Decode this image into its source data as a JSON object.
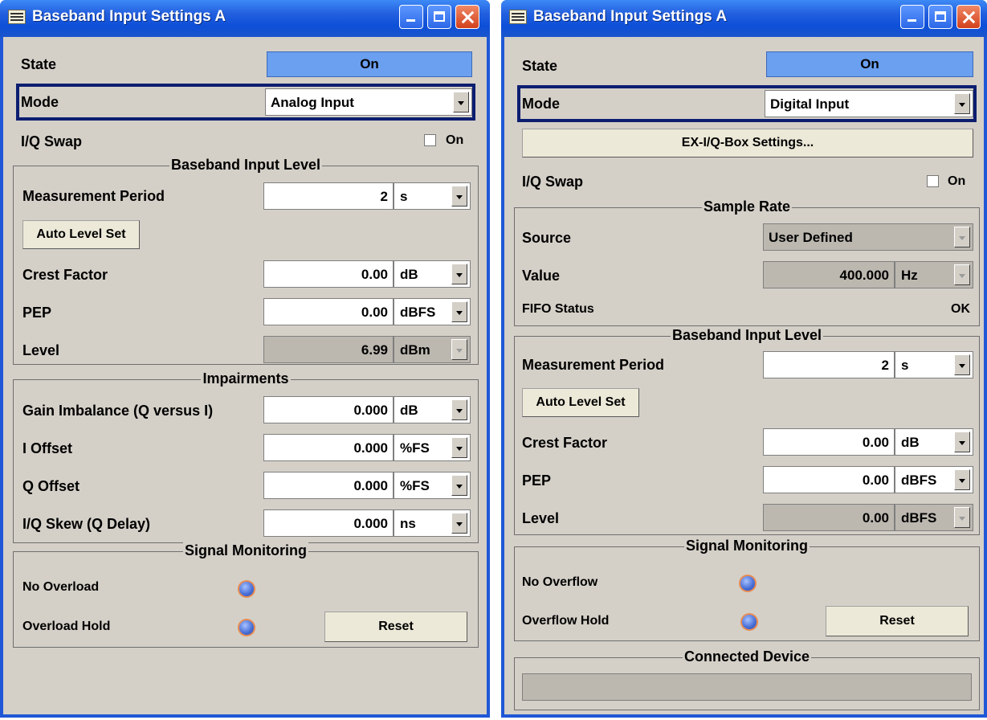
{
  "window_a": {
    "title": "Baseband Input Settings  A",
    "state": {
      "label": "State",
      "value": "On"
    },
    "mode": {
      "label": "Mode",
      "value": "Analog Input"
    },
    "iq_swap": {
      "label": "I/Q Swap",
      "checkbox_label": "On",
      "checked": false
    },
    "baseband_input_level": {
      "title": "Baseband Input Level",
      "measurement_period": {
        "label": "Measurement Period",
        "value": "2",
        "unit": "s"
      },
      "auto_level_set": "Auto Level Set",
      "crest_factor": {
        "label": "Crest Factor",
        "value": "0.00",
        "unit": "dB"
      },
      "pep": {
        "label": "PEP",
        "value": "0.00",
        "unit": "dBFS"
      },
      "level": {
        "label": "Level",
        "value": "6.99",
        "unit": "dBm"
      }
    },
    "impairments": {
      "title": "Impairments",
      "gain_imbalance": {
        "label": "Gain Imbalance (Q versus I)",
        "value": "0.000",
        "unit": "dB"
      },
      "i_offset": {
        "label": "I Offset",
        "value": "0.000",
        "unit": "%FS"
      },
      "q_offset": {
        "label": "Q Offset",
        "value": "0.000",
        "unit": "%FS"
      },
      "iq_skew": {
        "label": "I/Q Skew (Q Delay)",
        "value": "0.000",
        "unit": "ns"
      }
    },
    "signal_monitoring": {
      "title": "Signal Monitoring",
      "indicator_1": "No Overload",
      "indicator_2": "Overload Hold",
      "reset": "Reset"
    }
  },
  "window_b": {
    "title": "Baseband Input Settings  A",
    "state": {
      "label": "State",
      "value": "On"
    },
    "mode": {
      "label": "Mode",
      "value": "Digital Input"
    },
    "ex_iq_box": "EX-I/Q-Box Settings...",
    "iq_swap": {
      "label": "I/Q Swap",
      "checkbox_label": "On",
      "checked": false
    },
    "sample_rate": {
      "title": "Sample Rate",
      "source": {
        "label": "Source",
        "value": "User Defined"
      },
      "value": {
        "label": "Value",
        "value": "400.000",
        "unit": "Hz"
      },
      "fifo_status": {
        "label": "FIFO Status",
        "value": "OK"
      }
    },
    "baseband_input_level": {
      "title": "Baseband Input Level",
      "measurement_period": {
        "label": "Measurement Period",
        "value": "2",
        "unit": "s"
      },
      "auto_level_set": "Auto Level Set",
      "crest_factor": {
        "label": "Crest Factor",
        "value": "0.00",
        "unit": "dB"
      },
      "pep": {
        "label": "PEP",
        "value": "0.00",
        "unit": "dBFS"
      },
      "level": {
        "label": "Level",
        "value": "0.00",
        "unit": "dBFS"
      }
    },
    "signal_monitoring": {
      "title": "Signal Monitoring",
      "indicator_1": "No Overflow",
      "indicator_2": "Overflow Hold",
      "reset": "Reset"
    },
    "connected_device": {
      "title": "Connected Device",
      "value": ""
    }
  },
  "colors": {
    "titlebar": "#0d4fd8",
    "window_bg": "#d4d0c8",
    "state_on_button": "#6b9fef",
    "mode_highlight": "#0c1e70",
    "led": "#4d72d8"
  }
}
